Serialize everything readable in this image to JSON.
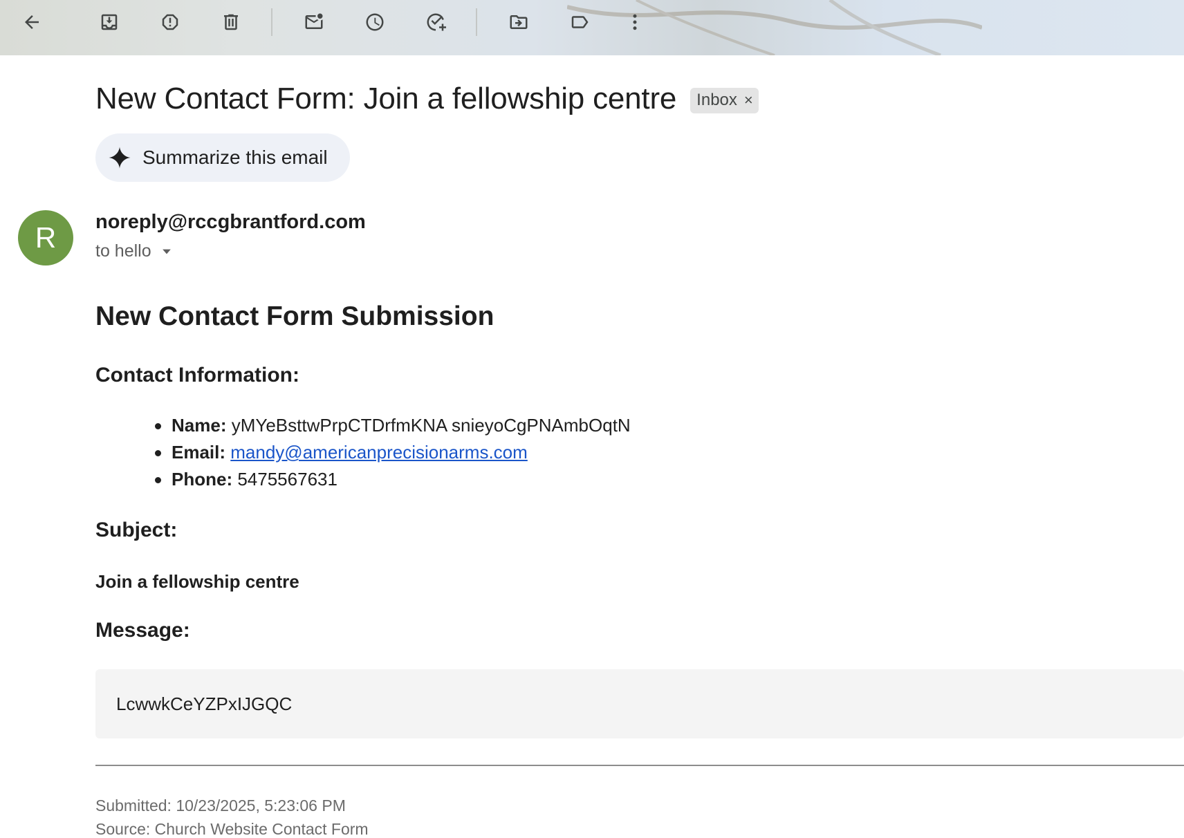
{
  "toolbar": {
    "buttons": [
      {
        "name": "back-button",
        "icon": "arrow-left-icon"
      },
      {
        "name": "archive-button",
        "icon": "archive-icon"
      },
      {
        "name": "report-spam-button",
        "icon": "report-icon"
      },
      {
        "name": "delete-button",
        "icon": "trash-icon"
      },
      {
        "name": "mark-unread-button",
        "icon": "mark-unread-icon"
      },
      {
        "name": "snooze-button",
        "icon": "clock-icon"
      },
      {
        "name": "add-task-button",
        "icon": "add-task-icon"
      },
      {
        "name": "move-to-button",
        "icon": "move-folder-icon"
      },
      {
        "name": "labels-button",
        "icon": "label-icon"
      },
      {
        "name": "more-button",
        "icon": "more-vertical-icon"
      }
    ]
  },
  "email": {
    "subject": "New Contact Form: Join a fellowship centre",
    "label_chip": "Inbox",
    "label_chip_close": "×",
    "summarize_label": "Summarize this email",
    "avatar_letter": "R",
    "avatar_color": "#6e9a45",
    "sender": "noreply@rccgbrantford.com",
    "recipient": "to hello"
  },
  "body": {
    "heading": "New Contact Form Submission",
    "contact_heading": "Contact Information:",
    "contact": {
      "name_label": "Name:",
      "name_value": "yMYeBsttwPrpCTDrfmKNA snieyoCgPNAmbOqtN",
      "email_label": "Email:",
      "email_value": "mandy@americanprecisionarms.com",
      "phone_label": "Phone:",
      "phone_value": "5475567631"
    },
    "subject_heading": "Subject:",
    "subject_value": "Join a fellowship centre",
    "message_heading": "Message:",
    "message_value": "LcwwkCeYZPxIJGQC",
    "submitted": "Submitted: 10/23/2025, 5:23:06 PM",
    "source": "Source: Church Website Contact Form"
  },
  "colors": {
    "link": "#1a55c9",
    "summarize_bg": "#eef1f7",
    "message_bg": "#f4f4f4"
  }
}
